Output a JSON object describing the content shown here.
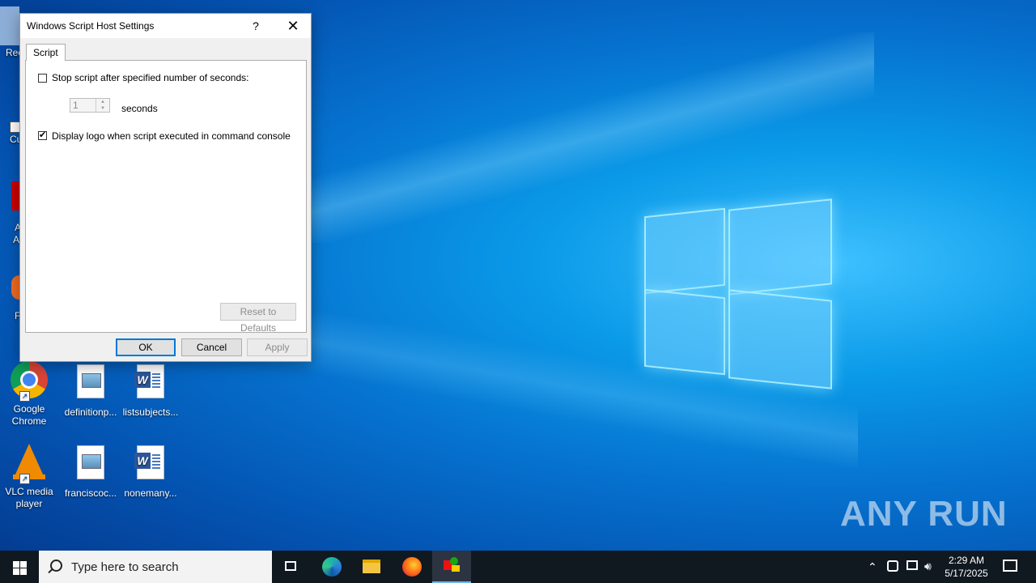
{
  "dialog": {
    "title": "Windows Script Host Settings",
    "help_glyph": "?",
    "close_glyph": "✕",
    "tab_label": "Script",
    "stop_script_label": "Stop script after specified number of seconds:",
    "stop_script_checked": false,
    "seconds_value": "1",
    "seconds_label": "seconds",
    "display_logo_label": "Display logo when script executed in command console",
    "display_logo_checked": true,
    "reset_label": "Reset to Defaults",
    "ok_label": "OK",
    "cancel_label": "Cancel",
    "apply_label": "Apply"
  },
  "desktop": {
    "icons": [
      {
        "label": "Google Chrome",
        "type": "chrome"
      },
      {
        "label": "definitionp...",
        "type": "image-doc"
      },
      {
        "label": "listsubjects...",
        "type": "word-doc"
      },
      {
        "label": "VLC media player",
        "type": "vlc"
      },
      {
        "label": "franciscoc...",
        "type": "image-doc"
      },
      {
        "label": "nonemany...",
        "type": "word-doc"
      }
    ],
    "partial_labels": [
      "Rec",
      "Cu",
      "A",
      "A",
      "F"
    ]
  },
  "taskbar": {
    "search_placeholder": "Type here to search",
    "clock_time": "2:29 AM",
    "clock_date": "5/17/2025"
  },
  "watermark": "ANY RUN",
  "colors": {
    "accent": "#0078d7",
    "taskbar": "#101820"
  }
}
